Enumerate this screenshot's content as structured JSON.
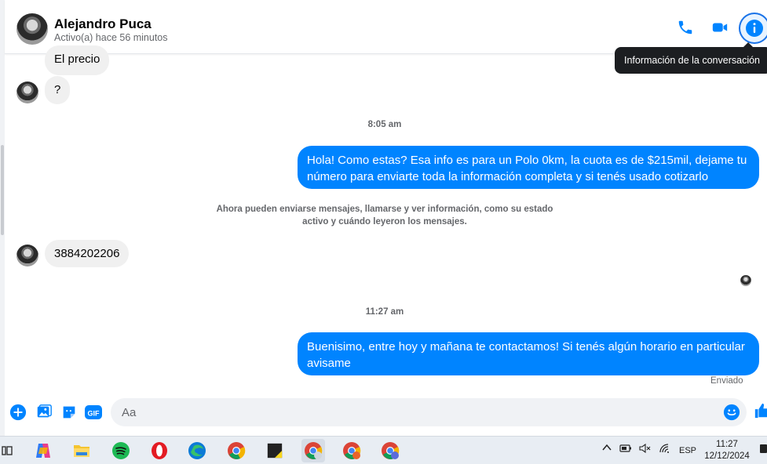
{
  "header": {
    "name": "Alejandro Puca",
    "status": "Activo(a) hace 56 minutos",
    "icons": [
      "phone-icon",
      "video-icon",
      "info-icon"
    ],
    "tooltip": "Información de la conversación"
  },
  "messages": {
    "m1": "El precio",
    "m2": "?",
    "time1": "8:05 am",
    "m3": "Hola! Como estas? Esa info es para un Polo 0km, la cuota es de $215mil, dejame tu número para enviarte toda la información completa y si tenés usado cotizarlo",
    "system_note": "Ahora pueden enviarse mensajes, llamarse y ver información, como su estado activo y cuándo leyeron los mensajes.",
    "m4": "3884202206",
    "time2": "11:27 am",
    "m5": "Buenisimo, entre hoy y mañana te contactamos! Si tenés algún horario en particular avisame",
    "sent_status": "Enviado"
  },
  "composer": {
    "placeholder": "Aa",
    "icons": [
      "plus-icon",
      "image-icon",
      "sticker-icon",
      "gif-icon",
      "emoji-icon",
      "like-icon"
    ],
    "gif_label": "GIF"
  },
  "colors": {
    "accent": "#0084ff",
    "bubble_in": "#f0f0f0",
    "tooltip_bg": "#1c1e21"
  },
  "taskbar": {
    "lang": "ESP",
    "time": "11:27",
    "date": "12/12/2024"
  }
}
